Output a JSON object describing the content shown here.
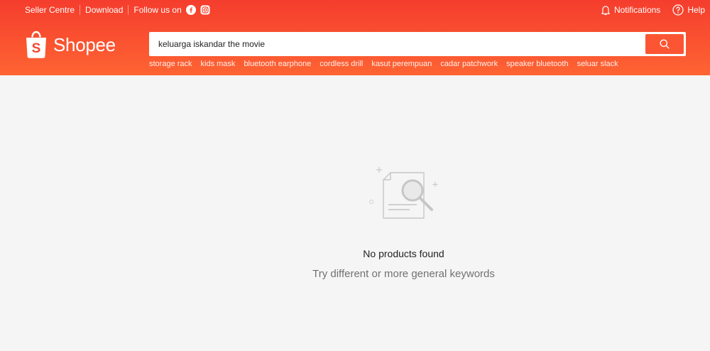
{
  "topbar": {
    "left_links": [
      "Seller Centre",
      "Download"
    ],
    "follow_label": "Follow us on",
    "notifications_label": "Notifications",
    "help_label": "Help"
  },
  "brand": {
    "name": "Shopee"
  },
  "search": {
    "value": "keluarga iskandar the movie"
  },
  "keywords": [
    "storage rack",
    "kids mask",
    "bluetooth earphone",
    "cordless drill",
    "kasut perempuan",
    "cadar patchwork",
    "speaker bluetooth",
    "seluar slack"
  ],
  "empty_state": {
    "title": "No products found",
    "subtitle": "Try different or more general keywords"
  },
  "colors": {
    "brand_orange": "#ee4d2d",
    "button_orange": "#fb5533"
  }
}
